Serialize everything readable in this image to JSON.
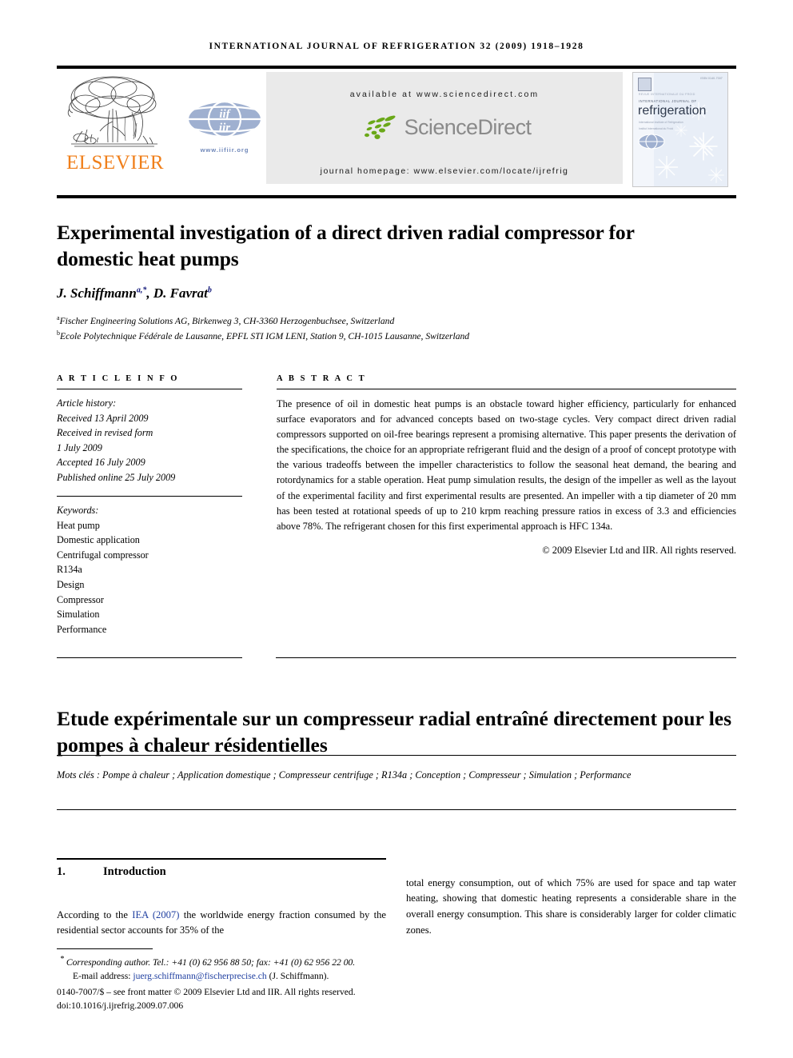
{
  "running_head": "INTERNATIONAL JOURNAL OF REFRIGERATION 32 (2009) 1918–1928",
  "banner": {
    "elsevier_wordmark": "ELSEVIER",
    "iir_url": "www.iifiir.org",
    "available_at": "available at www.sciencedirect.com",
    "sciencedirect_wordmark": "ScienceDirect",
    "journal_homepage": "journal homepage: www.elsevier.com/locate/ijrefrig",
    "cover": {
      "top_right": "ISSN 0140-7007",
      "line1": "REVUE INTERNATIONALE DU FROID",
      "line2": "INTERNATIONAL JOURNAL OF",
      "title": "refrigeration",
      "sub1": "International Institute of Refrigeration",
      "sub2": "Institut International du Froid"
    },
    "colors": {
      "elsevier_orange": "#F07F1A",
      "sciencedirect_grey": "#8a8a8a",
      "sciencedirect_green": "#6aa818",
      "banner_background": "#eaeaea",
      "iir_blue": "#6E86B8",
      "cover_blue": "#e8eef7"
    }
  },
  "article": {
    "title": "Experimental investigation of a direct driven radial compressor for domestic heat pumps",
    "authors_html": "J. Schiffmann<sup>a,*</sup>, D. Favrat<sup>b</sup>",
    "affiliations": [
      {
        "marker": "a",
        "text": "Fischer Engineering Solutions AG, Birkenweg 3, CH-3360 Herzogenbuchsee, Switzerland"
      },
      {
        "marker": "b",
        "text": "Ecole Polytechnique Fédérale de Lausanne, EPFL STI IGM LENI, Station 9, CH-1015 Lausanne, Switzerland"
      }
    ]
  },
  "article_info": {
    "label": "A R T I C L E   I N F O",
    "history_title": "Article history:",
    "history": [
      "Received 13 April 2009",
      "Received in revised form",
      "1 July 2009",
      "Accepted 16 July 2009",
      "Published online 25 July 2009"
    ],
    "keywords_title": "Keywords:",
    "keywords": [
      "Heat pump",
      "Domestic application",
      "Centrifugal compressor",
      "R134a",
      "Design",
      "Compressor",
      "Simulation",
      "Performance"
    ]
  },
  "abstract": {
    "label": "A B S T R A C T",
    "text": "The presence of oil in domestic heat pumps is an obstacle toward higher efficiency, particularly for enhanced surface evaporators and for advanced concepts based on two-stage cycles. Very compact direct driven radial compressors supported on oil-free bearings represent a promising alternative. This paper presents the derivation of the specifications, the choice for an appropriate refrigerant fluid and the design of a proof of concept prototype with the various tradeoffs between the impeller characteristics to follow the seasonal heat demand, the bearing and rotordynamics for a stable operation. Heat pump simulation results, the design of the impeller as well as the layout of the experimental facility and first experimental results are presented. An impeller with a tip diameter of 20 mm has been tested at rotational speeds of up to 210 krpm reaching pressure ratios in excess of 3.3 and efficiencies above 78%. The refrigerant chosen for this first experimental approach is HFC 134a.",
    "copyright": "© 2009 Elsevier Ltd and IIR. All rights reserved."
  },
  "french": {
    "title": "Etude expérimentale sur un compresseur radial entraîné directement pour les pompes à chaleur résidentielles",
    "keywords": "Mots clés : Pompe à chaleur ; Application domestique ; Compresseur centrifuge ; R134a ; Conception ; Compresseur ; Simulation ; Performance"
  },
  "body": {
    "section_number": "1.",
    "section_title": "Introduction",
    "left_column_pre": "According to the ",
    "left_column_link": "IEA (2007)",
    "left_column_post": " the worldwide energy fraction consumed by the residential sector accounts for 35% of the",
    "right_column": "total energy consumption, out of which 75% are used for space and tap water heating, showing that domestic heating represents a considerable share in the overall energy consumption. This share is considerably larger for colder climatic zones."
  },
  "footnotes": {
    "corresponding": "Corresponding author. Tel.: +41 (0) 62 956 88 50; fax: +41 (0) 62 956 22 00.",
    "email_label": "E-mail address: ",
    "email": "juerg.schiffmann@fischerprecise.ch",
    "email_suffix": " (J. Schiffmann).",
    "issn_line": "0140-7007/$ – see front matter © 2009 Elsevier Ltd and IIR. All rights reserved.",
    "doi_line": "doi:10.1016/j.ijrefrig.2009.07.006"
  }
}
